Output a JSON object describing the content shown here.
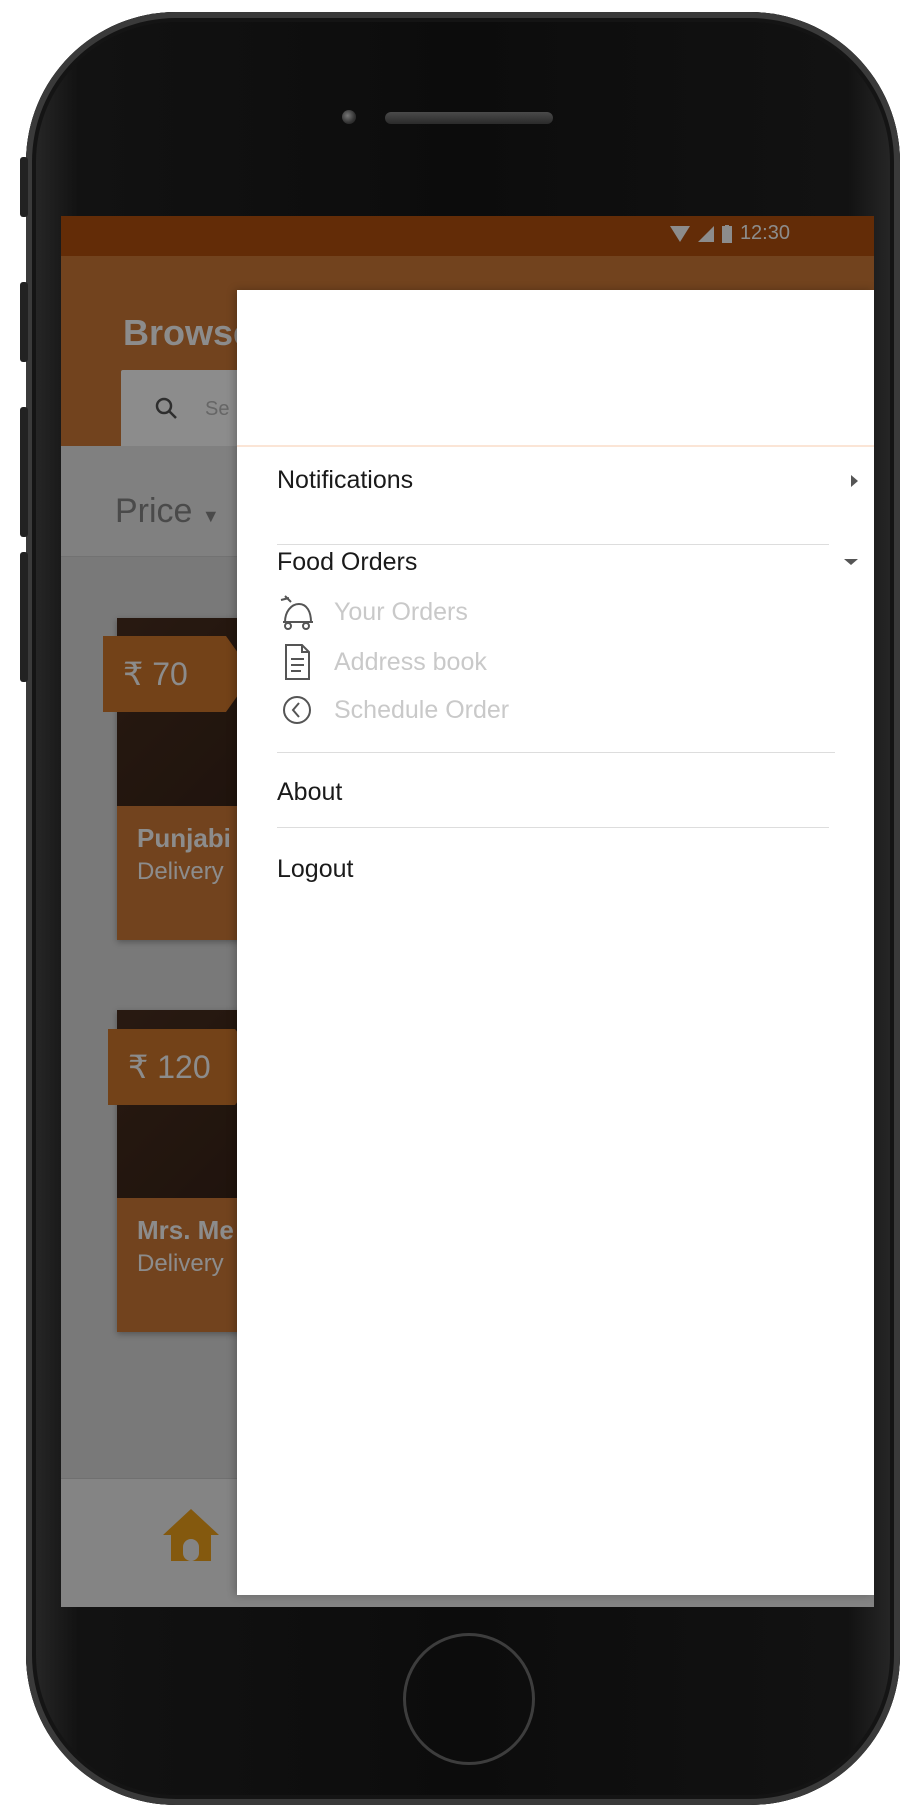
{
  "status_bar": {
    "time": "12:30"
  },
  "app": {
    "title": "Browse",
    "search_placeholder": "Se",
    "filter_price_label": "Price"
  },
  "cards": [
    {
      "price": "₹ 70",
      "name": "Punjabi",
      "subtitle": "Delivery"
    },
    {
      "price": "₹ 120",
      "name": "Mrs. Me",
      "subtitle": "Delivery"
    }
  ],
  "drawer": {
    "notifications": "Notifications",
    "food_orders": "Food Orders",
    "sub_items": [
      {
        "label": "Your Orders",
        "icon": "delivery-scooter-icon"
      },
      {
        "label": "Address book",
        "icon": "document-icon"
      },
      {
        "label": "Schedule Order",
        "icon": "clock-icon"
      }
    ],
    "about": "About",
    "logout": "Logout"
  },
  "colors": {
    "status_bar": "#b5500d",
    "app_bar": "#d07a38",
    "drawer_bg": "#ffffff",
    "sub_item_text": "#c9c9c9"
  }
}
